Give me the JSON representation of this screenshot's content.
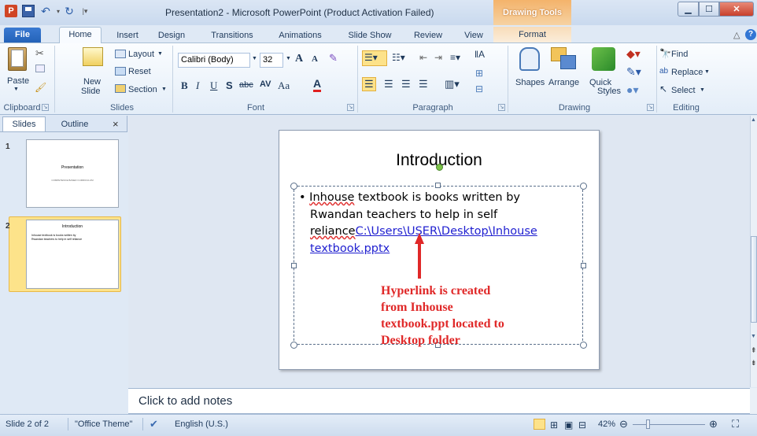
{
  "window": {
    "title": "Presentation2  -  Microsoft PowerPoint (Product Activation Failed)",
    "context_tab_group": "Drawing Tools"
  },
  "tabs": [
    "File",
    "Home",
    "Insert",
    "Design",
    "Transitions",
    "Animations",
    "Slide Show",
    "Review",
    "View",
    "Format"
  ],
  "ribbon": {
    "clipboard": {
      "paste": "Paste",
      "group": "Clipboard"
    },
    "slides": {
      "new_slide": "New",
      "new_slide2": "Slide",
      "layout": "Layout",
      "reset": "Reset",
      "section": "Section",
      "group": "Slides"
    },
    "font": {
      "font_name": "Calibri (Body)",
      "font_size": "32",
      "bold": "B",
      "italic": "I",
      "underline": "U",
      "shadow": "S",
      "strike": "abc",
      "spacing": "AV",
      "case": "Aa",
      "color": "A",
      "grow": "A",
      "shrink": "A",
      "group": "Font"
    },
    "paragraph": {
      "group": "Paragraph"
    },
    "drawing": {
      "shapes": "Shapes",
      "arrange": "Arrange",
      "quick": "Quick",
      "styles": "Styles",
      "group": "Drawing"
    },
    "editing": {
      "find": "Find",
      "replace": "Replace",
      "select": "Select",
      "group": "Editing"
    }
  },
  "left_pane": {
    "tab_slides": "Slides",
    "tab_outline": "Outline",
    "close": "×",
    "thumbs": [
      {
        "num": "1",
        "title": "Presentation",
        "subtitle": "COMPETENCE BASED CURRICULUM"
      },
      {
        "num": "2",
        "title": "Introduction",
        "subtitle": "Inhouse textbook is books written by Rwandan teachers to help in self reliance"
      }
    ]
  },
  "slide": {
    "title": "Introduction",
    "bullet": "•",
    "line1_squig": "Inhouse",
    "line1_rest": " textbook is books written by",
    "line2": "Rwandan teachers to help in self",
    "line3_squig": "reliance",
    "link_part1": "C:\\Users\\USER\\Desktop\\Inhouse",
    "link_part2": "textbook.pptx"
  },
  "annotation": {
    "line1": "Hyperlink is created",
    "line2": "from Inhouse",
    "line3": "textbook.ppt located to",
    "line4": "Desktop folder",
    "color": "#e02828"
  },
  "notes": {
    "placeholder": "Click to add notes"
  },
  "status": {
    "slide": "Slide 2 of 2",
    "theme": "\"Office Theme\"",
    "language": "English (U.S.)",
    "zoom": "42%"
  }
}
